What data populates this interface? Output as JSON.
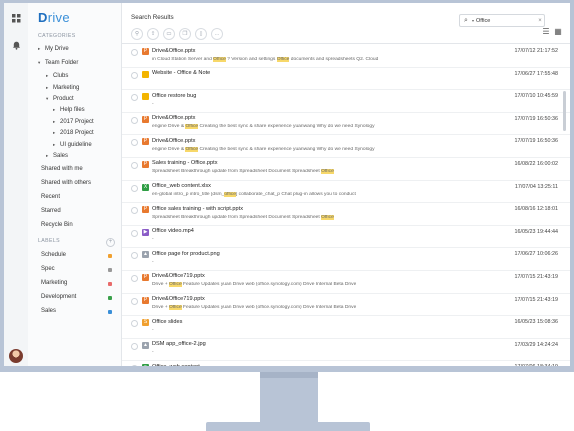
{
  "app": {
    "logo_initial": "D",
    "logo_rest": "rive"
  },
  "rail": {
    "icons": [
      "apps-grid-icon",
      "bell-icon"
    ]
  },
  "sidebar": {
    "categories_label": "CATEGORIES",
    "my_drive": "My Drive",
    "team_folder": "Team Folder",
    "clubs": "Clubs",
    "marketing": "Marketing",
    "product": "Product",
    "help_files": "Help files",
    "project_2017": "2017 Project",
    "project_2018": "2018 Project",
    "ui_guideline": "UI guideline",
    "sales": "Sales",
    "shared_with_me": "Shared with me",
    "shared_with_others": "Shared with others",
    "recent": "Recent",
    "starred": "Starred",
    "recycle_bin": "Recycle Bin",
    "labels_label": "LABELS",
    "labels": [
      {
        "name": "Schedule",
        "color": "#f0a030"
      },
      {
        "name": "Spec",
        "color": "#999999"
      },
      {
        "name": "Marketing",
        "color": "#e86a6a"
      },
      {
        "name": "Development",
        "color": "#3aa04a"
      },
      {
        "name": "Sales",
        "color": "#3a8fd8"
      }
    ]
  },
  "main": {
    "title": "Search Results",
    "search_value": "Office",
    "rows": [
      {
        "icon": "pptx",
        "name": "Drive&Office.pptx",
        "sub": [
          "in Cloud Station Server and ",
          "Office",
          " ? Version and settings ",
          "Office",
          " documents and spreadsheets Q2. Cloud"
        ],
        "date": "17/07/12 21:17:52"
      },
      {
        "icon": "folder",
        "name": "Website - Office & Note",
        "sub": [],
        "date": "17/06/27 17:55:48"
      },
      {
        "icon": "folder",
        "name": "Office restore bug",
        "sub": [
          "-"
        ],
        "date": "17/07/10 10:45:59"
      },
      {
        "icon": "pptx",
        "name": "Drive&Office.pptx",
        "sub": [
          "engine Drive & ",
          "Office",
          " Creating the best sync & share experience yuanwang Why do we need Synology"
        ],
        "date": "17/07/19 16:50:36"
      },
      {
        "icon": "pptx",
        "name": "Drive&Office.pptx",
        "sub": [
          "engine Drive & ",
          "Office",
          " Creating the best sync & share experience yuanwang Why do we need Synology"
        ],
        "date": "17/07/19 16:50:36"
      },
      {
        "icon": "pptx",
        "name": "Sales training - Office.pptx",
        "sub": [
          "Spreadsheet Breakthrough update from Spreadsheet Document Spreadsheet ",
          "Office",
          ""
        ],
        "date": "16/08/22 16:00:02"
      },
      {
        "icon": "xlsx",
        "name": "Office_web content.xlsx",
        "sub": [
          "en-global intro_p intro_title [dsm_",
          "office",
          "] collaborate_chat_p Chat plug-in allows you to conduct"
        ],
        "date": "17/07/04 13:25:11"
      },
      {
        "icon": "pptx",
        "name": "Office sales training - with script.pptx",
        "sub": [
          "Spreadsheet Breakthrough update from Spreadsheet Document Spreadsheet ",
          "Office",
          ""
        ],
        "date": "16/08/16 12:18:01"
      },
      {
        "icon": "video",
        "name": "Office video.mp4",
        "sub": [
          "-"
        ],
        "date": "16/05/23 19:44:44"
      },
      {
        "icon": "image",
        "name": "Office page for product.png",
        "sub": [
          "-"
        ],
        "date": "17/06/27 10:06:26"
      },
      {
        "icon": "pptx",
        "name": "Drive&Office719.pptx",
        "sub": [
          "Drive + ",
          "Office",
          " Feature Updates yuan Drive web (office.synology.com) Drive Internal Beta Drive"
        ],
        "date": "17/07/15 21:43:19"
      },
      {
        "icon": "pptx",
        "name": "Drive&Office719.pptx",
        "sub": [
          "Drive + ",
          "Office",
          " Feature Updates yuan Drive web (office.synology.com) Drive Internal Beta Drive"
        ],
        "date": "17/07/15 21:43:19"
      },
      {
        "icon": "slides",
        "name": "Office slides",
        "sub": [
          "-"
        ],
        "date": "16/05/23 15:08:36"
      },
      {
        "icon": "image",
        "name": "DSM app_office-2.jpg",
        "sub": [
          "-"
        ],
        "date": "17/03/29 14:24:24"
      },
      {
        "icon": "doc",
        "name": "Office_web content",
        "sub": [
          "-"
        ],
        "date": "17/07/06 18:34:19"
      }
    ]
  },
  "icon_colors": {
    "pptx": "#e8792f",
    "folder": "#f3b400",
    "xlsx": "#2f9e44",
    "video": "#8a5cc7",
    "image": "#9aa2ad",
    "slides": "#f0a030",
    "doc": "#2f9e44"
  }
}
